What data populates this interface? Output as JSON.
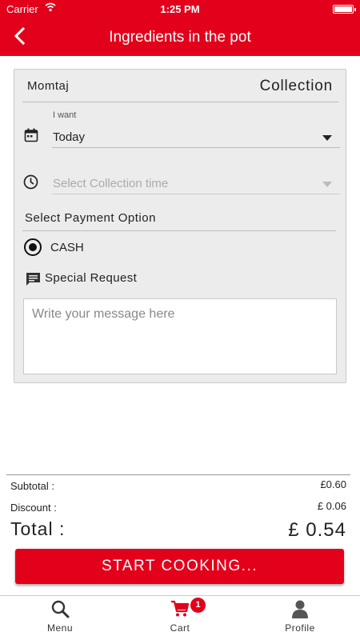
{
  "status_bar": {
    "carrier": "Carrier",
    "time": "1:25 PM"
  },
  "header": {
    "title": "Ingredients in the pot"
  },
  "order": {
    "restaurant_name": "Momtaj",
    "order_type": "Collection",
    "when_label": "I want",
    "when_value": "Today",
    "collection_time_placeholder": "Select Collection time",
    "payment_label": "Select Payment Option",
    "payment_option": "CASH",
    "special_request_label": "Special Request",
    "message_placeholder": "Write your message here"
  },
  "totals": {
    "subtotal_label": "Subtotal :",
    "subtotal_value": "£0.60",
    "discount_label": "Discount :",
    "discount_value": "£ 0.06",
    "total_label": "Total :",
    "total_value": "£ 0.54"
  },
  "cta": {
    "label": "START COOKING..."
  },
  "tabbar": {
    "items": [
      {
        "label": "Menu",
        "icon": "search-icon"
      },
      {
        "label": "Cart",
        "icon": "cart-icon",
        "badge": "1"
      },
      {
        "label": "Profile",
        "icon": "person-icon"
      }
    ]
  },
  "colors": {
    "brand": "#e3001b",
    "card_bg": "#ececec"
  }
}
